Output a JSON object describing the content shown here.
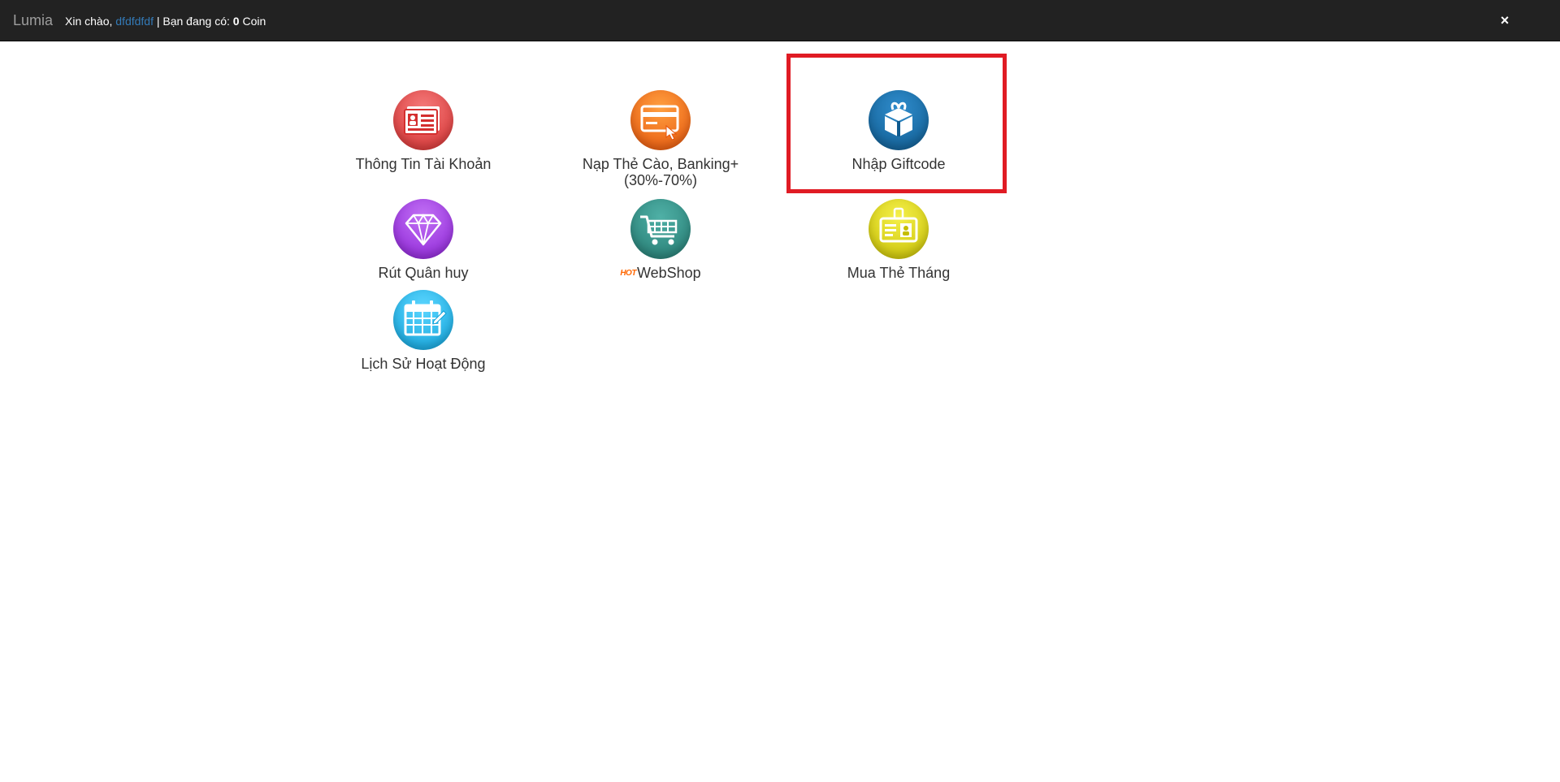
{
  "topbar": {
    "brand": "Lumia",
    "greeting_prefix": "Xin chào,",
    "username": "dfdfdfdf",
    "balance_prefix": "| Bạn đang có:",
    "balance_value": "0",
    "balance_unit": "Coin",
    "close_icon": "×"
  },
  "menu": {
    "account_info": {
      "label": "Thông Tin Tài Khoản",
      "icon": "id-card-icon",
      "color": "#e84a4a"
    },
    "recharge": {
      "label_line1": "Nạp Thẻ Cào, Banking+",
      "label_line2": "(30%-70%)",
      "icon": "credit-card-icon",
      "color": "#f06a12"
    },
    "giftcode": {
      "label": "Nhập Giftcode",
      "icon": "gift-box-icon",
      "color": "#1a6fa8"
    },
    "withdraw": {
      "label": "Rút Quân huy",
      "icon": "diamond-icon",
      "color": "#9b2fe0"
    },
    "webshop": {
      "hot_badge": "HOT",
      "label": "WebShop",
      "icon": "shopping-cart-icon",
      "color": "#2f8f86"
    },
    "monthly_card": {
      "label": "Mua Thẻ Tháng",
      "icon": "badge-card-icon",
      "color": "#d6d000"
    },
    "history": {
      "label": "Lịch Sử Hoạt Động",
      "icon": "calendar-icon",
      "color": "#1bb6e8"
    }
  },
  "highlight_color": "#e01b24"
}
